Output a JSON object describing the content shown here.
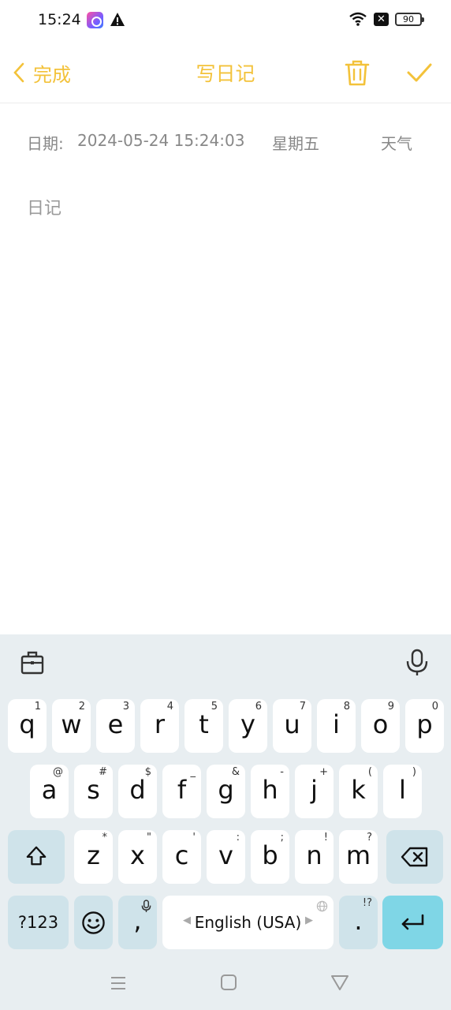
{
  "status_bar": {
    "time": "15:24",
    "battery": "90"
  },
  "header": {
    "back_label": "完成",
    "title": "写日记"
  },
  "entry": {
    "date_label": "日期:",
    "date_value": "2024-05-24 15:24:03",
    "weekday": "星期五",
    "weather": "天气",
    "diary_placeholder": "日记"
  },
  "keyboard": {
    "row1": [
      {
        "key": "q",
        "hint": "1"
      },
      {
        "key": "w",
        "hint": "2"
      },
      {
        "key": "e",
        "hint": "3"
      },
      {
        "key": "r",
        "hint": "4"
      },
      {
        "key": "t",
        "hint": "5"
      },
      {
        "key": "y",
        "hint": "6"
      },
      {
        "key": "u",
        "hint": "7"
      },
      {
        "key": "i",
        "hint": "8"
      },
      {
        "key": "o",
        "hint": "9"
      },
      {
        "key": "p",
        "hint": "0"
      }
    ],
    "row2": [
      {
        "key": "a",
        "hint": "@"
      },
      {
        "key": "s",
        "hint": "#"
      },
      {
        "key": "d",
        "hint": "$"
      },
      {
        "key": "f",
        "hint": "_"
      },
      {
        "key": "g",
        "hint": "&"
      },
      {
        "key": "h",
        "hint": "-"
      },
      {
        "key": "j",
        "hint": "+"
      },
      {
        "key": "k",
        "hint": "("
      },
      {
        "key": "l",
        "hint": ")"
      }
    ],
    "row3": [
      {
        "key": "z",
        "hint": "*"
      },
      {
        "key": "x",
        "hint": "\""
      },
      {
        "key": "c",
        "hint": "'"
      },
      {
        "key": "v",
        "hint": ":"
      },
      {
        "key": "b",
        "hint": ";"
      },
      {
        "key": "n",
        "hint": "!"
      },
      {
        "key": "m",
        "hint": "?"
      }
    ],
    "symbols_label": "?123",
    "comma": ",",
    "space_label": "English (USA)",
    "period": ".",
    "period_hint": "!?"
  }
}
